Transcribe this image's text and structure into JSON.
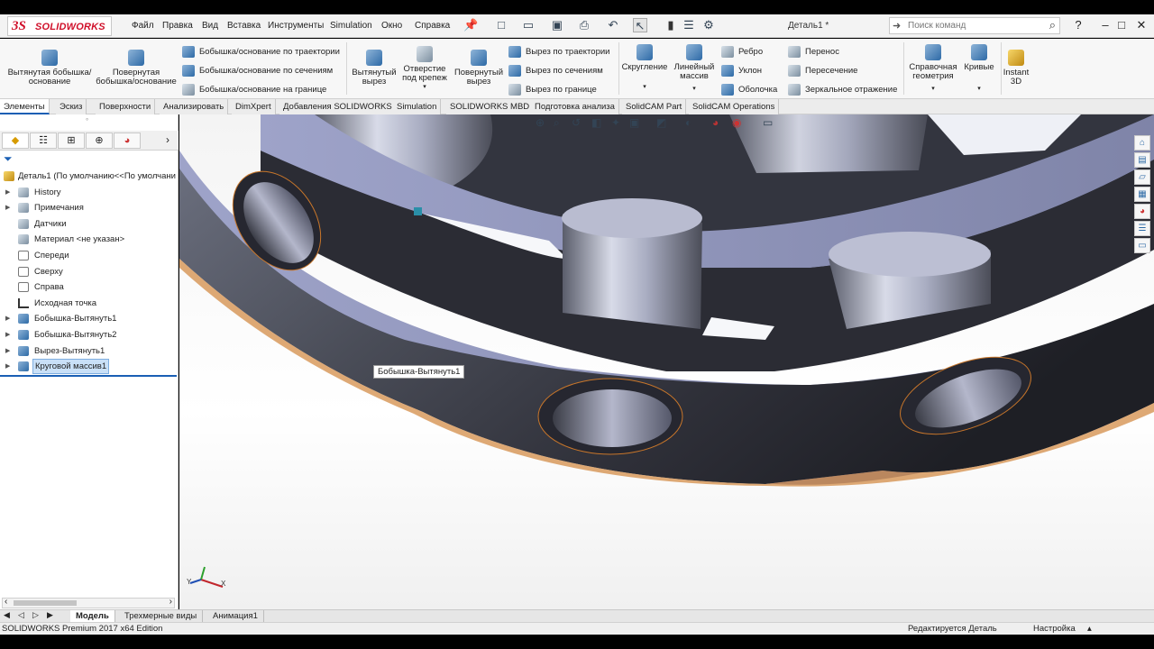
{
  "app": {
    "brand_mark": "3S",
    "brand_name": "SOLIDWORKS"
  },
  "menu": [
    "Файл",
    "Правка",
    "Вид",
    "Вставка",
    "Инструменты",
    "Simulation",
    "Окно",
    "Справка"
  ],
  "doc_title": "Деталь1 *",
  "search": {
    "placeholder": "Поиск команд"
  },
  "ribbon": {
    "extruded_boss": "Вытянутая бобышка/основание",
    "revolved_boss": "Повернутая бобышка/основание",
    "swept_boss": "Бобышка/основание по траектории",
    "lofted_boss": "Бобышка/основание по сечениям",
    "boundary_boss": "Бобышка/основание на границе",
    "extruded_cut": "Вытянутый вырез",
    "hole_wizard": "Отверстие под крепеж",
    "revolved_cut": "Повернутый вырез",
    "swept_cut": "Вырез по траектории",
    "lofted_cut": "Вырез по сечениям",
    "boundary_cut": "Вырез по границе",
    "fillet": "Скругление",
    "linear_pattern": "Линейный массив",
    "rib": "Ребро",
    "draft": "Уклон",
    "shell": "Оболочка",
    "move": "Перенос",
    "intersect": "Пересечение",
    "mirror": "Зеркальное отражение",
    "ref_geometry": "Справочная геометрия",
    "curves": "Кривые",
    "instant3d": "Instant 3D"
  },
  "tabs": [
    "Элементы",
    "Эскиз",
    "Поверхности",
    "Анализировать",
    "DimXpert",
    "Добавления SOLIDWORKS",
    "Simulation",
    "SOLIDWORKS MBD",
    "Подготовка анализа",
    "SolidCAM Part",
    "SolidCAM Operations"
  ],
  "tree": {
    "root": "Деталь1  (По умолчанию<<По умолчани",
    "items": [
      "History",
      "Примечания",
      "Датчики",
      "Материал <не указан>",
      "Спереди",
      "Сверху",
      "Справа",
      "Исходная точка",
      "Бобышка-Вытянуть1",
      "Бобышка-Вытянуть2",
      "Вырез-Вытянуть1",
      "Круговой массив1"
    ]
  },
  "tooltip": "Бобышка-Вытянуть1",
  "bottom_tabs": [
    "Модель",
    "Трехмерные виды",
    "Анимация1"
  ],
  "status": {
    "edition": "SOLIDWORKS Premium 2017 x64 Edition",
    "editing": "Редактируется Деталь",
    "custom": "Настройка"
  },
  "triad": {
    "x": "X",
    "y": "Y"
  }
}
